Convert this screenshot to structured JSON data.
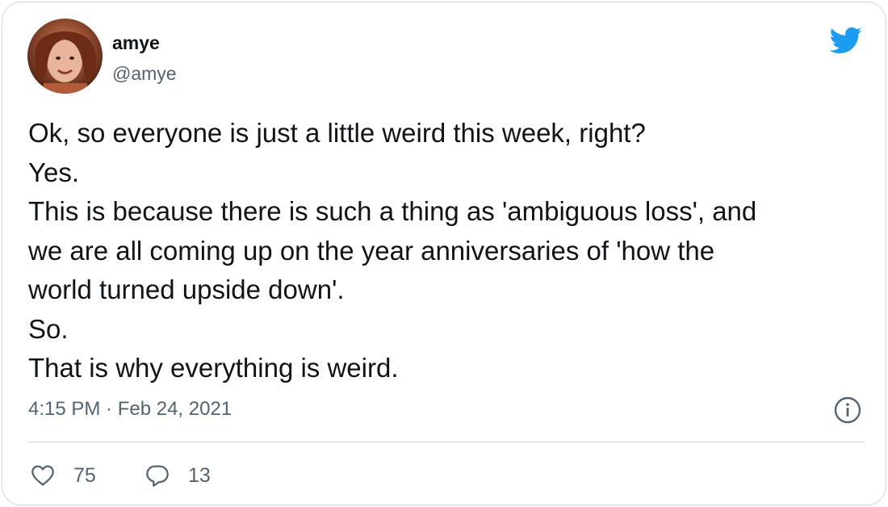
{
  "tweet": {
    "author_name": "amye",
    "author_handle": "@amye",
    "lines": [
      "Ok, so everyone is just a little weird this week, right?",
      "Yes.",
      "This is because there is such a thing as 'ambiguous loss', and",
      "we are all coming up on the year anniversaries of 'how the",
      "world turned upside down'.",
      "So.",
      "That is why everything is weird."
    ],
    "timestamp": "4:15 PM · Feb 24, 2021",
    "like_count": "75",
    "reply_count": "13"
  },
  "icons": {
    "brand": "twitter-bird-icon",
    "info": "info-icon",
    "like": "heart-icon",
    "reply": "reply-bubble-icon"
  },
  "colors": {
    "brand": "#1d9bf0",
    "text": "#0f1419",
    "secondary": "#536471",
    "border": "#cfd9de"
  }
}
